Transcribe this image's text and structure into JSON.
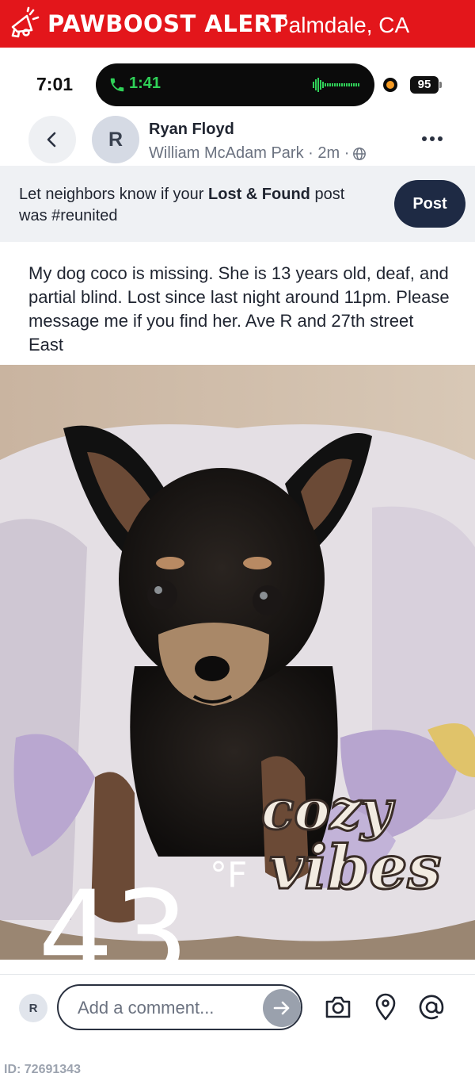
{
  "alert": {
    "title": "PAWBOOST ALERT",
    "city": "Palmdale, CA"
  },
  "status_bar": {
    "time": "7:01",
    "call_timer": "1:41",
    "battery": "95"
  },
  "post": {
    "author_initial": "R",
    "author_name": "Ryan Floyd",
    "location": "William McAdam Park",
    "age": "2m",
    "reunite_prefix": "Let neighbors know if your ",
    "reunite_bold": "Lost & Found",
    "reunite_suffix": " post was #reunited",
    "post_button": "Post",
    "body": "My dog coco is missing. She is 13 years old, deaf, and partial blind. Lost since last night around 11pm. Please message me if you find her. Ave R and 27th street East"
  },
  "photo": {
    "overlay_temp": "43",
    "overlay_unit": "°F",
    "sticker_line1": "cozy",
    "sticker_line2": "vibes"
  },
  "comment_bar": {
    "avatar_initial": "R",
    "placeholder": "Add a comment..."
  },
  "footer": {
    "id_label": "ID: 72691343"
  },
  "colors": {
    "alert_red": "#e3161b",
    "post_button_bg": "#1e2a44",
    "call_green": "#2fd158"
  }
}
